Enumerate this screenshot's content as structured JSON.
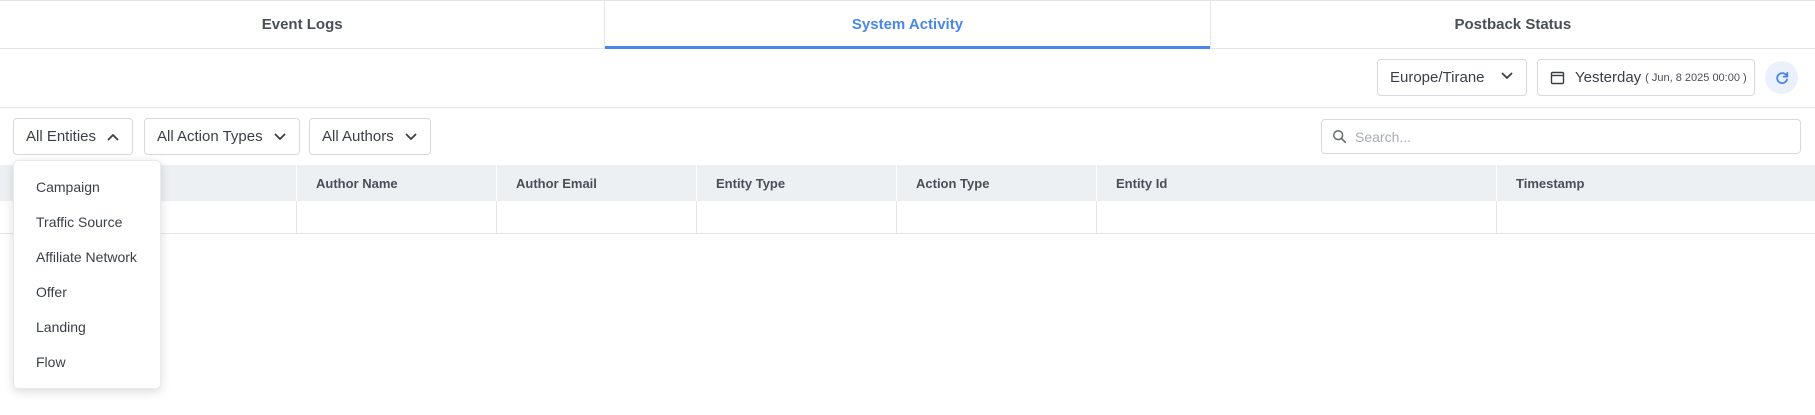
{
  "tabs": [
    {
      "label": "Event Logs",
      "active": false
    },
    {
      "label": "System Activity",
      "active": true
    },
    {
      "label": "Postback Status",
      "active": false
    }
  ],
  "toolbar": {
    "timezone": "Europe/Tirane",
    "date_label": "Yesterday",
    "date_detail": "( Jun, 8 2025 00:00 )",
    "refresh_icon": "refresh-icon",
    "calendar_icon": "calendar-icon"
  },
  "filters": {
    "entities": "All Entities",
    "action_types": "All Action Types",
    "authors": "All Authors"
  },
  "search": {
    "placeholder": "Search...",
    "value": ""
  },
  "table": {
    "columns": [
      "",
      "Author Name",
      "Author Email",
      "Entity Type",
      "Action Type",
      "Entity Id",
      "Timestamp"
    ]
  },
  "entities_dropdown": {
    "open": true,
    "items": [
      "Campaign",
      "Traffic Source",
      "Affiliate Network",
      "Offer",
      "Landing",
      "Flow"
    ]
  },
  "colors": {
    "accent": "#4a86e8",
    "header_bg": "#edf0f3",
    "border": "#e3e6ea",
    "text": "#3a3f47"
  }
}
